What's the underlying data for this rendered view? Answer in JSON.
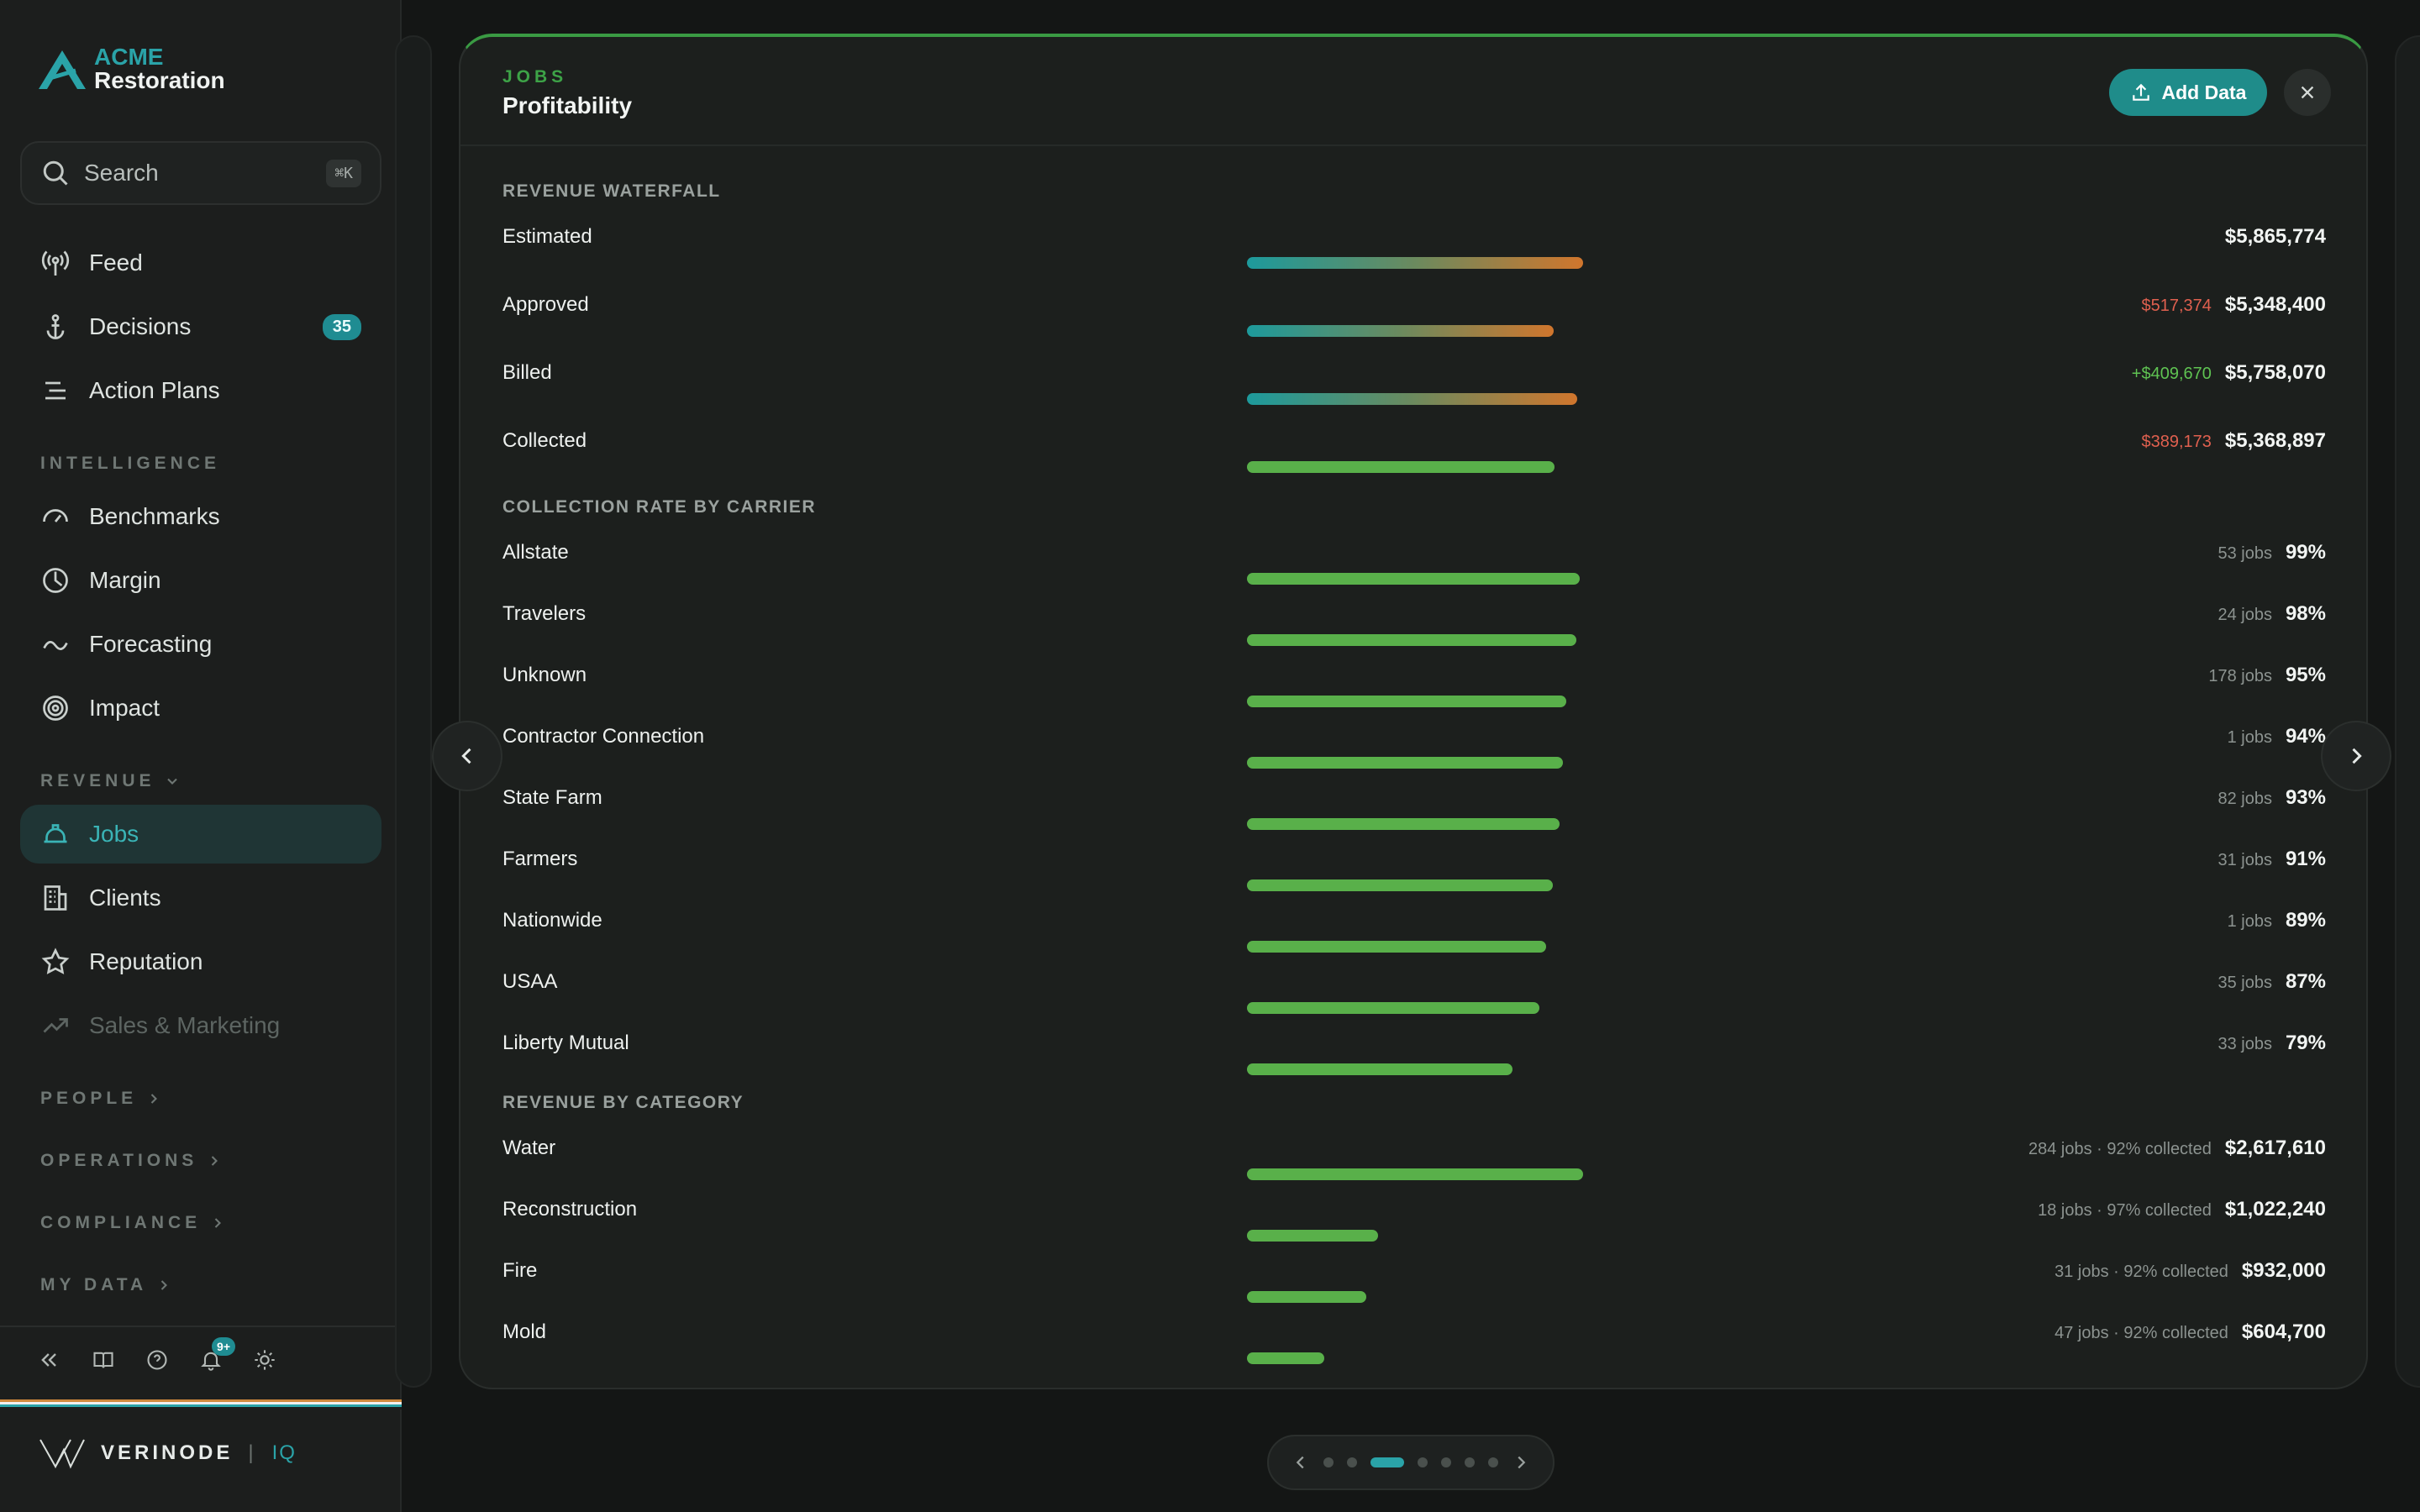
{
  "sidebar": {
    "logo": {
      "line1": "ACME",
      "line2": "Restoration"
    },
    "search": {
      "label": "Search",
      "shortcut": "⌘K"
    },
    "items": [
      {
        "label": "Feed",
        "icon": "broadcast-icon"
      },
      {
        "label": "Decisions",
        "icon": "anchor-icon",
        "badge": "35"
      },
      {
        "label": "Action Plans",
        "icon": "list-icon"
      }
    ],
    "sections": {
      "intelligence": "INTELLIGENCE",
      "revenue": "REVENUE",
      "people": "PEOPLE",
      "operations": "OPERATIONS",
      "compliance": "COMPLIANCE",
      "my_data": "MY DATA"
    },
    "intelligence_items": [
      {
        "label": "Benchmarks",
        "icon": "gauge-icon"
      },
      {
        "label": "Margin",
        "icon": "clock-pie-icon"
      },
      {
        "label": "Forecasting",
        "icon": "trend-curve-icon"
      },
      {
        "label": "Impact",
        "icon": "target-icon"
      }
    ],
    "revenue_items": [
      {
        "label": "Jobs",
        "icon": "hard-hat-icon"
      },
      {
        "label": "Clients",
        "icon": "building-icon"
      },
      {
        "label": "Reputation",
        "icon": "star-icon"
      },
      {
        "label": "Sales & Marketing",
        "icon": "trending-up-icon"
      }
    ],
    "notifications": "9+",
    "brand": {
      "name": "VERINODE",
      "sep": "|",
      "suffix": "IQ"
    }
  },
  "card": {
    "eyebrow": "JOBS",
    "title": "Profitability",
    "add_button": "Add Data",
    "waterfall": {
      "title": "REVENUE WATERFALL",
      "rows": [
        {
          "label": "Estimated",
          "delta": "",
          "value": "$5,865,774",
          "fill": 1.0
        },
        {
          "label": "Approved",
          "delta": "$517,374",
          "delta_sign": "neg",
          "value": "$5,348,400",
          "fill": 0.912
        },
        {
          "label": "Billed",
          "delta": "+$409,670",
          "delta_sign": "pos",
          "value": "$5,758,070",
          "fill": 0.982
        },
        {
          "label": "Collected",
          "delta": "$389,173",
          "delta_sign": "neg",
          "value": "$5,368,897",
          "fill": 0.915
        }
      ]
    },
    "carriers": {
      "title": "COLLECTION RATE BY CARRIER",
      "rows": [
        {
          "label": "Allstate",
          "meta": "53 jobs",
          "value": "99%",
          "fill": 0.99
        },
        {
          "label": "Travelers",
          "meta": "24 jobs",
          "value": "98%",
          "fill": 0.98
        },
        {
          "label": "Unknown",
          "meta": "178 jobs",
          "value": "95%",
          "fill": 0.95
        },
        {
          "label": "Contractor Connection",
          "meta": "1 jobs",
          "value": "94%",
          "fill": 0.94
        },
        {
          "label": "State Farm",
          "meta": "82 jobs",
          "value": "93%",
          "fill": 0.93
        },
        {
          "label": "Farmers",
          "meta": "31 jobs",
          "value": "91%",
          "fill": 0.91
        },
        {
          "label": "Nationwide",
          "meta": "1 jobs",
          "value": "89%",
          "fill": 0.89
        },
        {
          "label": "USAA",
          "meta": "35 jobs",
          "value": "87%",
          "fill": 0.87
        },
        {
          "label": "Liberty Mutual",
          "meta": "33 jobs",
          "value": "79%",
          "fill": 0.79
        }
      ]
    },
    "categories": {
      "title": "REVENUE BY CATEGORY",
      "rows": [
        {
          "label": "Water",
          "meta": "284 jobs · 92% collected",
          "value": "$2,617,610",
          "fill": 1.0
        },
        {
          "label": "Reconstruction",
          "meta": "18 jobs · 97% collected",
          "value": "$1,022,240",
          "fill": 0.39
        },
        {
          "label": "Fire",
          "meta": "31 jobs · 92% collected",
          "value": "$932,000",
          "fill": 0.356
        },
        {
          "label": "Mold",
          "meta": "47 jobs · 92% collected",
          "value": "$604,700",
          "fill": 0.231
        }
      ]
    }
  },
  "pager": {
    "pages": 7,
    "active": 2
  }
}
